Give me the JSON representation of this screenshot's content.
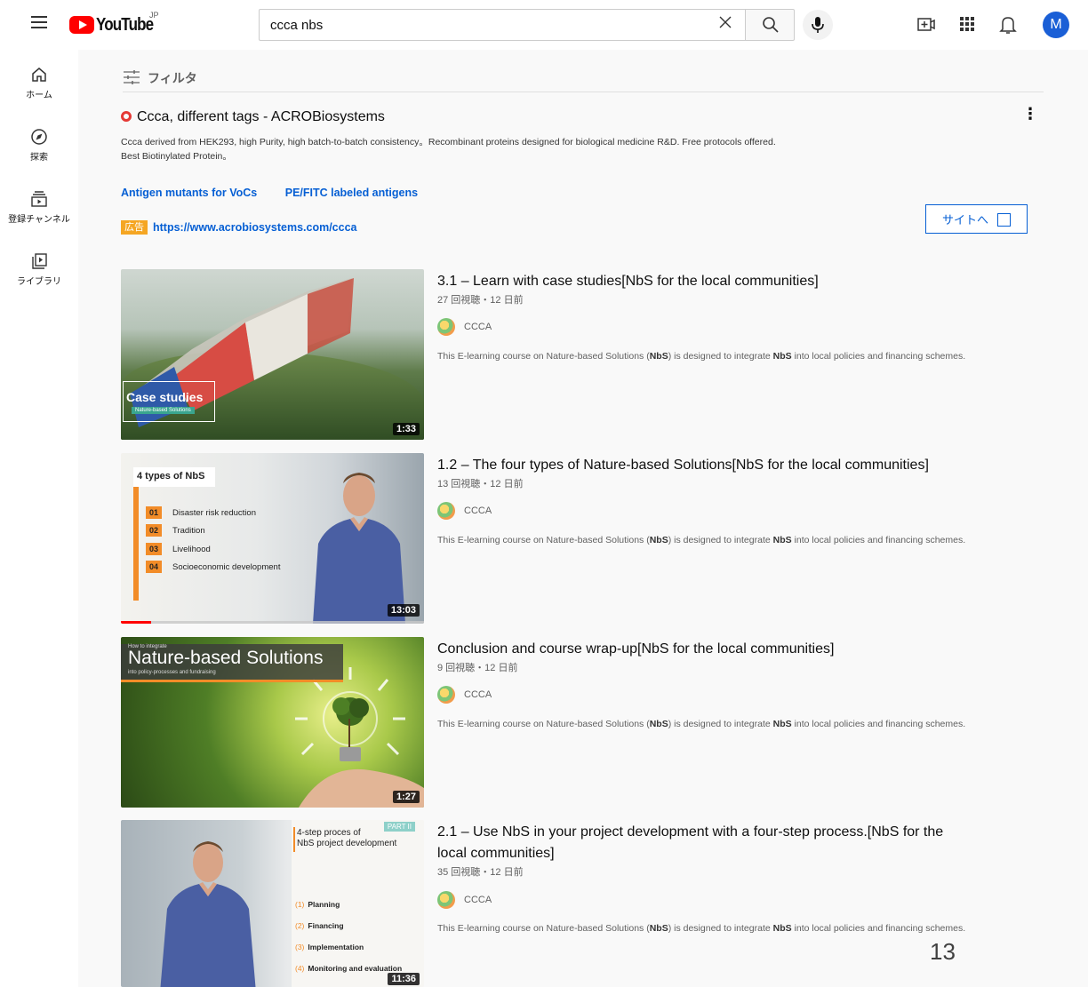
{
  "header": {
    "logo_text": "YouTube",
    "region": "JP",
    "search_value": "ccca nbs",
    "avatar_letter": "M"
  },
  "sidebar": {
    "items": [
      {
        "label": "ホーム",
        "icon": "home-icon"
      },
      {
        "label": "探索",
        "icon": "compass-icon"
      },
      {
        "label": "登録チャンネル",
        "icon": "subscriptions-icon"
      },
      {
        "label": "ライブラリ",
        "icon": "library-icon"
      }
    ]
  },
  "filter": {
    "label": "フィルタ"
  },
  "ad": {
    "title": "Ccca, different tags - ACROBiosystems",
    "desc_line1": "Ccca derived from HEK293, high Purity, high batch-to-batch consistency。Recombinant proteins designed for biological medicine R&D. Free protocols offered.",
    "desc_line2": "Best Biotinylated Protein。",
    "links": [
      "Antigen mutants for VoCs",
      "PE/FITC labeled antigens"
    ],
    "badge": "広告",
    "url": "https://www.acrobiosystems.com/ccca",
    "button_label": "サイトへ"
  },
  "videos": [
    {
      "title": "3.1 – Learn with case studies[NbS for the local communities]",
      "meta": "27 回視聴・12 日前",
      "channel": "CCCA",
      "duration": "1:33",
      "thumb_text": "Case studies",
      "thumb_sub": "Nature-based Solutions"
    },
    {
      "title": "1.2 – The four types of Nature-based Solutions[NbS for the local communities]",
      "meta": "13 回視聴・12 日前",
      "channel": "CCCA",
      "duration": "13:03",
      "thumb_header": "4 types of NbS",
      "thumb_items": [
        {
          "num": "01",
          "text": "Disaster risk reduction"
        },
        {
          "num": "02",
          "text": "Tradition"
        },
        {
          "num": "03",
          "text": "Livelihood"
        },
        {
          "num": "04",
          "text": "Socioeconomic development"
        }
      ]
    },
    {
      "title": "Conclusion and course wrap-up[NbS for the local communities]",
      "meta": "9 回視聴・12 日前",
      "channel": "CCCA",
      "duration": "1:27",
      "thumb_pre": "How to integrate",
      "thumb_title": "Nature-based Solutions",
      "thumb_sub": "into policy-processes and fundraising"
    },
    {
      "title_line1": "2.1 – Use NbS in your project development with a four-step process.[NbS for the",
      "title_line2": "local communities]",
      "meta": "35 回視聴・12 日前",
      "channel": "CCCA",
      "duration": "11:36",
      "thumb_part": "PART II",
      "thumb_title1": "4-step proces of",
      "thumb_title2": "NbS project development",
      "thumb_steps": [
        {
          "num": "(1)",
          "text": "Planning"
        },
        {
          "num": "(2)",
          "text": "Financing"
        },
        {
          "num": "(3)",
          "text": "Implementation"
        },
        {
          "num": "(4)",
          "text": "Monitoring and evaluation"
        }
      ]
    }
  ],
  "description": {
    "pre": "This E-learning course on Nature-based Solutions (",
    "bold1": "NbS",
    "mid": ") is designed to integrate ",
    "bold2": "NbS",
    "post": " into local policies and financing schemes."
  },
  "page_number": "13"
}
